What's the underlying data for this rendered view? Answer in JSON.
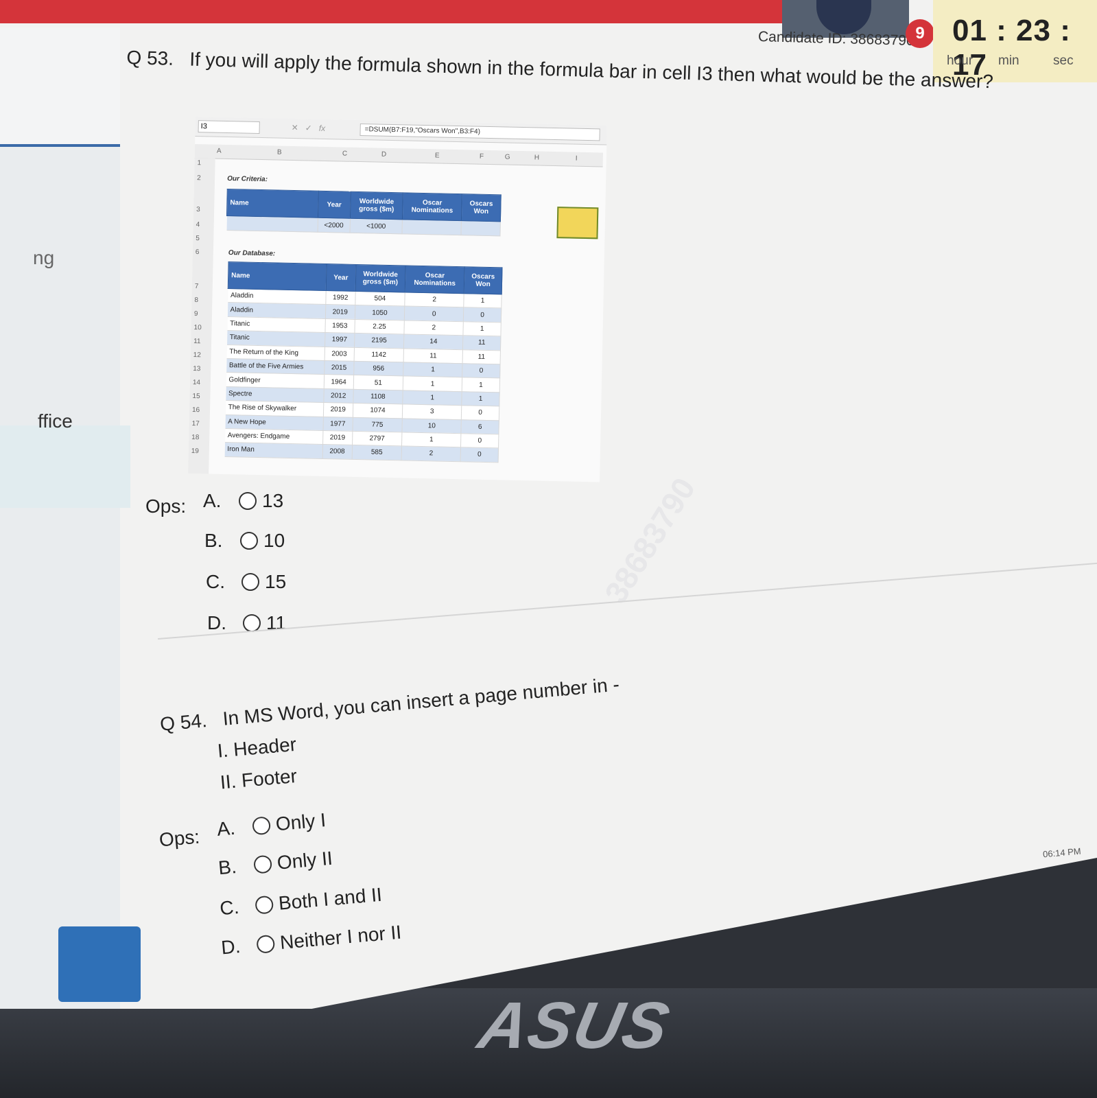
{
  "header": {
    "candidate_label": "Candidate ID: 38683790",
    "badge": "9",
    "timer": {
      "value": "01 : 23 : 17",
      "hour": "hour",
      "min": "min",
      "sec": "sec"
    }
  },
  "sidebar": {
    "items": [
      {
        "label": "ng"
      },
      {
        "label": "ffice"
      }
    ]
  },
  "q53": {
    "number": "Q 53.",
    "text": "If you will apply the formula shown in the formula bar in cell I3 then what would be the answer?",
    "sheet": {
      "name_box": "I3",
      "formula": "=DSUM(B7:F19,\"Oscars Won\",B3:F4)",
      "columns": [
        "A",
        "B",
        "C",
        "D",
        "E",
        "F",
        "G",
        "H",
        "I"
      ],
      "criteria_label": "Our Criteria:",
      "database_label": "Our Database:",
      "headers": [
        "Name",
        "Year",
        "Worldwide gross ($m)",
        "Oscar Nominations",
        "Oscars Won"
      ],
      "criteria_row": [
        "",
        "<2000",
        "<1000",
        "",
        ""
      ],
      "rows": [
        [
          "Aladdin",
          "1992",
          "504",
          "2",
          "1"
        ],
        [
          "Aladdin",
          "2019",
          "1050",
          "0",
          "0"
        ],
        [
          "Titanic",
          "1953",
          "2.25",
          "2",
          "1"
        ],
        [
          "Titanic",
          "1997",
          "2195",
          "14",
          "11"
        ],
        [
          "The Return of the King",
          "2003",
          "1142",
          "11",
          "11"
        ],
        [
          "Battle of the Five Armies",
          "2015",
          "956",
          "1",
          "0"
        ],
        [
          "Goldfinger",
          "1964",
          "51",
          "1",
          "1"
        ],
        [
          "Spectre",
          "2012",
          "1108",
          "1",
          "1"
        ],
        [
          "The Rise of Skywalker",
          "2019",
          "1074",
          "3",
          "0"
        ],
        [
          "A New Hope",
          "1977",
          "775",
          "10",
          "6"
        ],
        [
          "Avengers: Endgame",
          "2019",
          "2797",
          "1",
          "0"
        ],
        [
          "Iron Man",
          "2008",
          "585",
          "2",
          "0"
        ]
      ]
    },
    "ops_label": "Ops:",
    "options": [
      {
        "letter": "A.",
        "text": "13"
      },
      {
        "letter": "B.",
        "text": "10"
      },
      {
        "letter": "C.",
        "text": "15"
      },
      {
        "letter": "D.",
        "text": "11"
      }
    ]
  },
  "q54": {
    "number": "Q 54.",
    "text": "In MS Word, you can insert a page number in -",
    "items": [
      "I. Header",
      "II. Footer"
    ],
    "ops_label": "Ops:",
    "options": [
      {
        "letter": "A.",
        "text": "Only I"
      },
      {
        "letter": "B.",
        "text": "Only II"
      },
      {
        "letter": "C.",
        "text": "Both I and II"
      },
      {
        "letter": "D.",
        "text": "Neither I nor II"
      }
    ]
  },
  "taskbar_clock": "06:14 PM",
  "hardware": {
    "brand": "ASUS"
  },
  "colors": {
    "accent_red": "#d4343a",
    "table_header_blue": "#3c6cb3",
    "timer_bg": "#f4edc3"
  }
}
